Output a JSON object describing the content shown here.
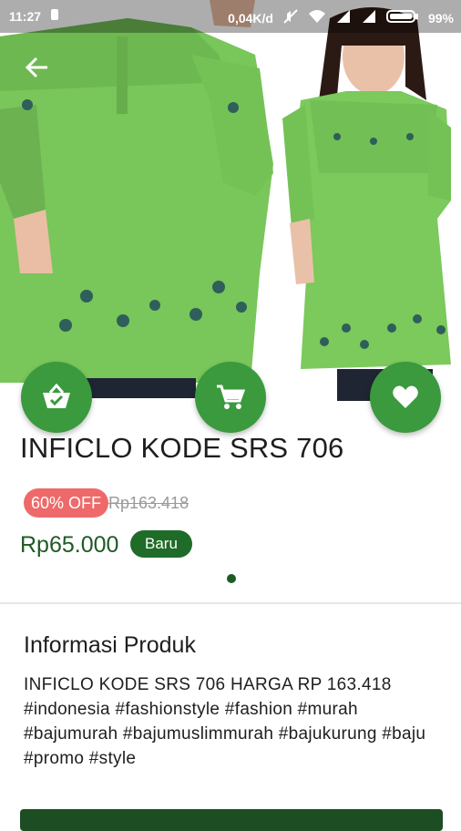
{
  "status_bar": {
    "time": "11:27",
    "network_speed": "0,04K/d",
    "battery": "99%"
  },
  "product": {
    "title": "INFICLO KODE SRS 706",
    "discount_badge": "60% OFF",
    "original_price": "Rp163.418",
    "price": "Rp65.000",
    "condition_badge": "Baru"
  },
  "info": {
    "heading": "Informasi Produk",
    "description": "INFICLO KODE SRS 706 HARGA RP 163.418 #indonesia #fashionstyle #fashion #murah #bajumurah #bajumuslimmurah #bajukurung #baju #promo #style"
  },
  "colors": {
    "accent_green": "#3a9a3d",
    "price_green": "#1f5a24",
    "discount_red": "#ee6a6a"
  },
  "icons": [
    "back-arrow-icon",
    "basket-icon",
    "cart-icon",
    "heart-icon"
  ]
}
